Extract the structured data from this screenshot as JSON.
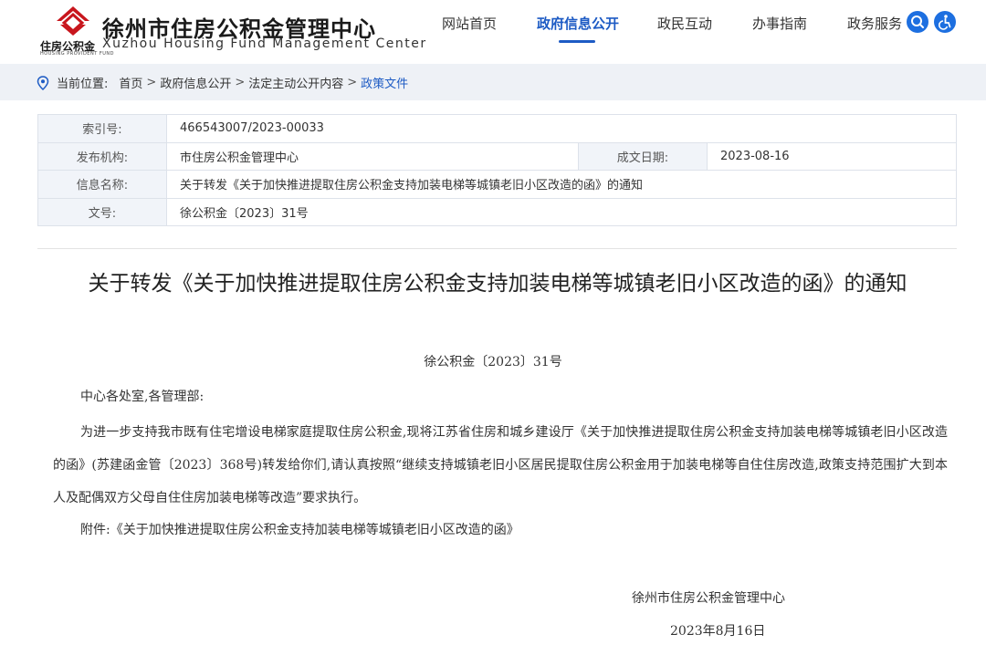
{
  "header": {
    "site_name": "徐州市住房公积金管理中心",
    "site_name_small": "住房公积金",
    "site_name_small_en": "HOUSING PROVIDENT FUND",
    "site_name_en": "Xuzhou Housing Fund Management Center",
    "nav": [
      {
        "label": "网站首页",
        "active": false
      },
      {
        "label": "政府信息公开",
        "active": true
      },
      {
        "label": "政民互动",
        "active": false
      },
      {
        "label": "办事指南",
        "active": false
      },
      {
        "label": "政务服务",
        "active": false
      }
    ],
    "icons": [
      "search-icon",
      "accessibility-icon"
    ],
    "accent_color": "#1d5bc4",
    "logo_color": "#c8161d"
  },
  "breadcrumb": {
    "prefix": "当前位置:",
    "items": [
      "首页",
      "政府信息公开",
      "法定主动公开内容",
      "政策文件"
    ],
    "separator": ">"
  },
  "info": {
    "index_label": "索引号:",
    "index_value": "466543007/2023-00033",
    "org_label": "发布机构:",
    "org_value": "市住房公积金管理中心",
    "date_label": "成文日期:",
    "date_value": "2023-08-16",
    "name_label": "信息名称:",
    "name_value": "关于转发《关于加快推进提取住房公积金支持加装电梯等城镇老旧小区改造的函》的通知",
    "docno_label": "文号:",
    "docno_value": "徐公积金〔2023〕31号"
  },
  "article": {
    "title": "关于转发《关于加快推进提取住房公积金支持加装电梯等城镇老旧小区改造的函》的通知",
    "doc_number": "徐公积金〔2023〕31号",
    "salutation": "中心各处室,各管理部:",
    "main_paragraph": "为进一步支持我市既有住宅增设电梯家庭提取住房公积金,现将江苏省住房和城乡建设厅《关于加快推进提取住房公积金支持加装电梯等城镇老旧小区改造的函》(苏建函金管〔2023〕368号)转发给你们,请认真按照“继续支持城镇老旧小区居民提取住房公积金用于加装电梯等自住住房改造,政策支持范围扩大到本人及配偶双方父母自住住房加装电梯等改造”要求执行。",
    "attachment": "附件:《关于加快推进提取住房公积金支持加装电梯等城镇老旧小区改造的函》",
    "sign_org": "徐州市住房公积金管理中心",
    "sign_date": "2023年8月16日"
  }
}
